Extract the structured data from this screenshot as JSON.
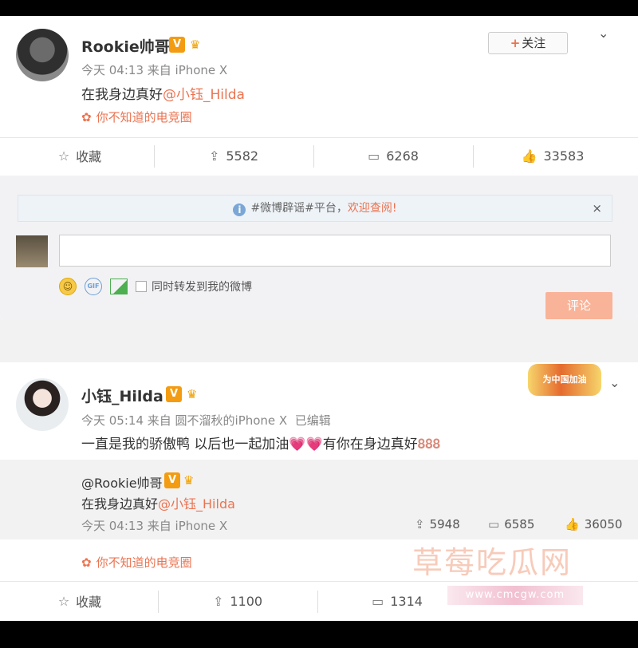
{
  "post1": {
    "username": "Rookie帅哥",
    "verified_badge": "V",
    "crown_icon": "crown-icon",
    "time_source": "今天 04:13 来自 iPhone X",
    "text_main": "在我身边真好",
    "mention": "@小钰_Hilda",
    "topic": "你不知道的电竞圈",
    "follow_label": "关注",
    "actions": {
      "favorite": "收藏",
      "repost": "5582",
      "comment": "6268",
      "like": "33583"
    }
  },
  "comment_box": {
    "notice_prefix": "#微博辟谣#平台，",
    "notice_highlight": "欢迎查阅!",
    "input_placeholder": "",
    "repost_check_label": "同时转发到我的微博",
    "submit_label": "评论",
    "close_glyph": "×"
  },
  "post2": {
    "username": "小钰_Hilda",
    "verified_badge": "V",
    "time_source": "今天 05:14 来自 圆不溜秋的iPhone X",
    "edited": "已编辑",
    "text": "一直是我的骄傲鸭 以后也一起加油",
    "text_tail": "有你在身边真好",
    "hearts": "💗💗",
    "badge_text": "为中国加油",
    "quoted": {
      "username": "@Rookie帅哥",
      "text_main": "在我身边真好",
      "mention": "@小钰_Hilda",
      "time_source": "今天 04:13 来自 iPhone X",
      "repost": "5948",
      "comment": "6585",
      "like": "36050"
    },
    "topic": "你不知道的电竞圈",
    "actions": {
      "favorite": "收藏",
      "repost": "1100",
      "comment": "1314"
    }
  },
  "watermark": {
    "text": "草莓吃瓜网",
    "url": "www.cmcgw.com"
  },
  "colors": {
    "accent": "#eb7350",
    "vip": "#f39c12"
  }
}
